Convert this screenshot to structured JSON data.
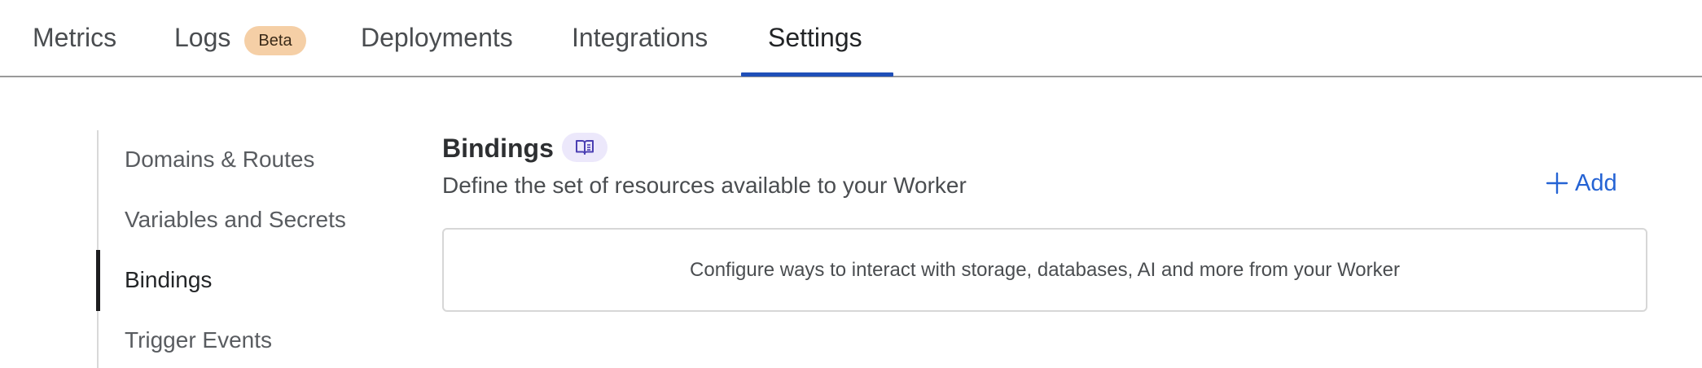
{
  "tabs": [
    {
      "label": "Metrics"
    },
    {
      "label": "Logs",
      "badge": "Beta"
    },
    {
      "label": "Deployments"
    },
    {
      "label": "Integrations"
    },
    {
      "label": "Settings",
      "active": true
    }
  ],
  "sidebar": {
    "items": [
      {
        "label": "Domains & Routes"
      },
      {
        "label": "Variables and Secrets"
      },
      {
        "label": "Bindings",
        "active": true
      },
      {
        "label": "Trigger Events"
      }
    ]
  },
  "section": {
    "title": "Bindings",
    "description": "Define the set of resources available to your Worker",
    "add_label": "Add",
    "empty_message": "Configure ways to interact with storage, databases, AI and more from your Worker"
  },
  "icons": {
    "doc_chip": "book-open-icon",
    "add": "plus-icon"
  },
  "colors": {
    "accent_blue": "#2563d4",
    "tab_underline": "#1f4fb8",
    "beta_badge_bg": "#f5cfa6",
    "doc_chip_bg": "#ece8fb"
  }
}
